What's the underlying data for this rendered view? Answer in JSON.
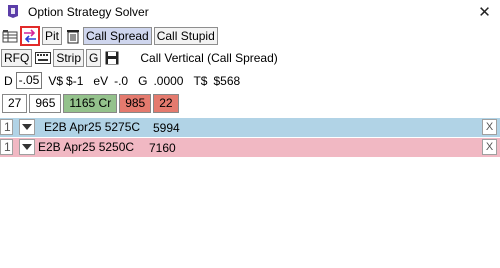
{
  "window": {
    "title": "Option Strategy Solver"
  },
  "toolbar1": {
    "pit_label": "Pit",
    "strategy_label": "Call Spread",
    "alt_strategy_label": "Call Stupid"
  },
  "toolbar2": {
    "rfq_label": "RFQ",
    "strip_label": "Strip",
    "g_label": "G",
    "description": "Call Vertical (Call Spread)"
  },
  "greeks": {
    "d_label": "D",
    "d_value": "-.05",
    "vdollar_label": "V$",
    "vdollar_value": "$-1",
    "ev_label": "eV",
    "ev_value": "-.0",
    "g_label": "G",
    "g_value": ".0000",
    "tdollar_label": "T$",
    "tdollar_value": "$568"
  },
  "quote": {
    "bid_size": "27",
    "bid": "965",
    "mid": "1165 Cr",
    "ask": "985",
    "ask_size": "22"
  },
  "legs": [
    {
      "qty": "1",
      "symbol": "E2B Apr25 5275C",
      "price": "5994",
      "remove": "X"
    },
    {
      "qty": "1",
      "symbol": "E2B Apr25 5250C",
      "price": "7160",
      "remove": "X"
    }
  ],
  "colors": {
    "leg_buy": "#b1d3e6",
    "leg_sell": "#f1b8c3",
    "mid": "#94c28c",
    "ask": "#e47a6e",
    "selected": "#cfd6ee",
    "highlight": "#e22a2a"
  }
}
